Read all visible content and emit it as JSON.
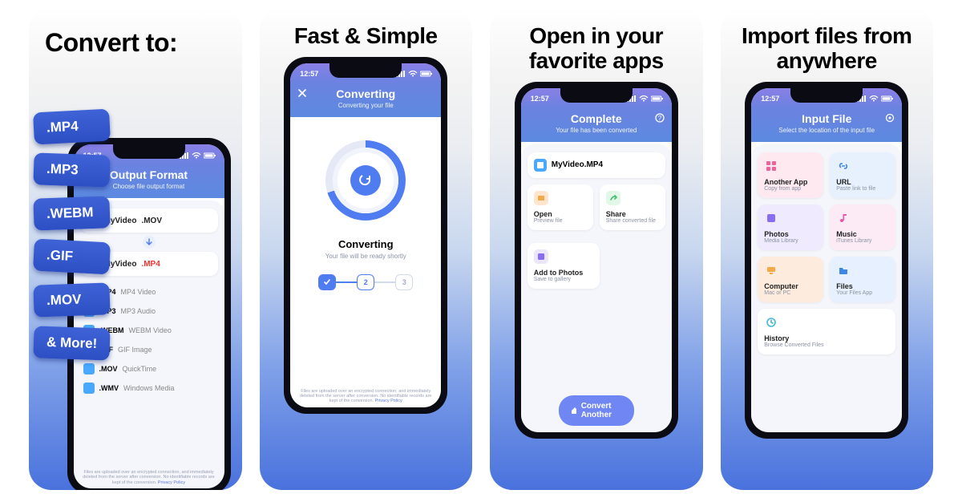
{
  "status_time": "12:57",
  "disclaimer": {
    "text": "Files are uploaded over an encrypted connection, and immediately deleted from the server after conversion. No identifiable records are kept of the conversion.",
    "privacy": "Privacy Policy"
  },
  "panels": [
    {
      "headline": "Convert to:",
      "app_header_title": "Output Format",
      "app_header_sub": "Choose file output format",
      "badges": [
        ".MP4",
        ".MP3",
        ".WEBM",
        ".GIF",
        ".MOV",
        "& More!"
      ],
      "file_in_name": "MyVideo",
      "file_in_ext": ".MOV",
      "file_out_name": "MyVideo",
      "file_out_ext": ".MP4",
      "formats": [
        {
          "ext": ".MP4",
          "desc": "MP4 Video"
        },
        {
          "ext": ".MP3",
          "desc": "MP3 Audio"
        },
        {
          "ext": ".WEBM",
          "desc": "WEBM Video"
        },
        {
          "ext": ".GIF",
          "desc": "GIF Image"
        },
        {
          "ext": ".MOV",
          "desc": "QuickTime"
        },
        {
          "ext": ".WMV",
          "desc": "Windows Media"
        }
      ]
    },
    {
      "headline": "Fast & Simple",
      "app_header_title": "Converting",
      "app_header_sub": "Converting your file",
      "status_title": "Converting",
      "status_sub": "Your file will be ready shortly",
      "steps": [
        "✓",
        "2",
        "3"
      ]
    },
    {
      "headline": "Open in your favorite apps",
      "app_header_title": "Complete",
      "app_header_sub": "Your file has been converted",
      "result_file": "MyVideo.MP4",
      "actions": [
        {
          "title": "Open",
          "sub": "Preview file"
        },
        {
          "title": "Share",
          "sub": "Share converted file"
        },
        {
          "title": "Add to Photos",
          "sub": "Save to gallery"
        }
      ],
      "convert_another": "Convert Another"
    },
    {
      "headline": "Import files from anywhere",
      "app_header_title": "Input File",
      "app_header_sub": "Select the location of the input file",
      "sources": [
        {
          "title": "Another App",
          "sub": "Copy from app"
        },
        {
          "title": "URL",
          "sub": "Paste link to file"
        },
        {
          "title": "Photos",
          "sub": "Media Library"
        },
        {
          "title": "Music",
          "sub": "iTunes Library"
        },
        {
          "title": "Computer",
          "sub": "Mac or PC"
        },
        {
          "title": "Files",
          "sub": "Your Files App"
        },
        {
          "title": "History",
          "sub": "Browse Converted Files"
        }
      ]
    }
  ]
}
